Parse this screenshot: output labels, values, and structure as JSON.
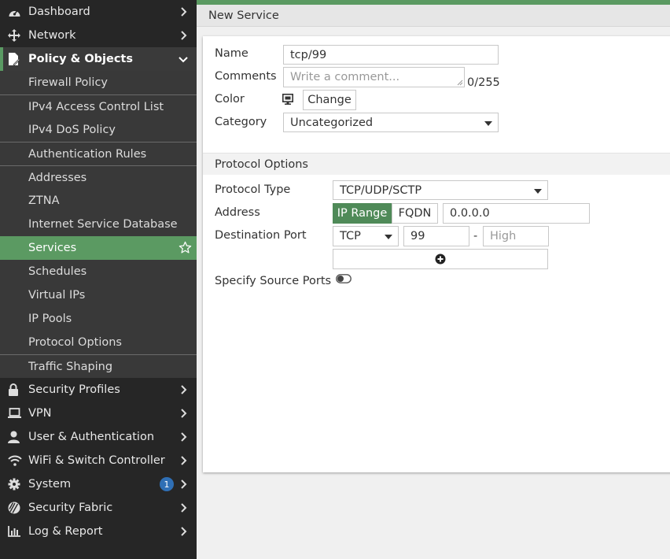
{
  "sidebar": {
    "dashboard": "Dashboard",
    "network": "Network",
    "policy_objects": "Policy & Objects",
    "sub_items": [
      "Firewall Policy",
      "IPv4 Access Control List",
      "IPv4 DoS Policy",
      "Authentication Rules",
      "Addresses",
      "ZTNA",
      "Internet Service Database",
      "Services",
      "Schedules",
      "Virtual IPs",
      "IP Pools",
      "Protocol Options",
      "Traffic Shaping"
    ],
    "security_profiles": "Security Profiles",
    "vpn": "VPN",
    "user_auth": "User & Authentication",
    "wifi_switch": "WiFi & Switch Controller",
    "system": "System",
    "system_badge": "1",
    "security_fabric": "Security Fabric",
    "log_report": "Log & Report"
  },
  "header": {
    "title": "New Service"
  },
  "form": {
    "name_label": "Name",
    "name_value": "tcp/99",
    "comments_label": "Comments",
    "comments_placeholder": "Write a comment...",
    "comments_counter": "0/255",
    "color_label": "Color",
    "change_label": "Change",
    "category_label": "Category",
    "category_value": "Uncategorized"
  },
  "protocol": {
    "section_title": "Protocol Options",
    "type_label": "Protocol Type",
    "type_value": "TCP/UDP/SCTP",
    "address_label": "Address",
    "ip_range_label": "IP Range",
    "fqdn_label": "FQDN",
    "address_value": "0.0.0.0",
    "dest_port_label": "Destination Port",
    "dest_protocol": "TCP",
    "dest_port_low": "99",
    "dash": "-",
    "dest_port_high_placeholder": "High",
    "source_ports_label": "Specify Source Ports"
  },
  "colors": {
    "accent": "#5b9a62",
    "sidebar_bg": "#262626",
    "submenu_bg": "#393939",
    "badge": "#2f6fb5"
  }
}
